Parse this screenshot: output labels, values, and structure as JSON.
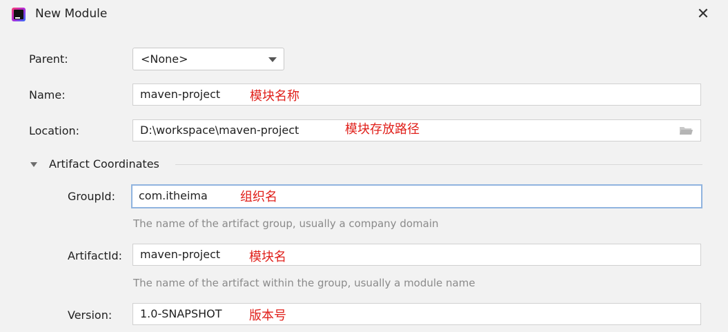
{
  "window": {
    "title": "New Module",
    "close_glyph": "✕"
  },
  "form": {
    "parent": {
      "label": "Parent:",
      "value": "<None>"
    },
    "name": {
      "label": "Name:",
      "value": "maven-project",
      "annotation": "模块名称"
    },
    "location": {
      "label": "Location:",
      "value": "D:\\workspace\\maven-project",
      "annotation": "模块存放路径"
    },
    "section": {
      "label": "Artifact Coordinates"
    },
    "group_id": {
      "label": "GroupId:",
      "value": "com.itheima",
      "annotation": "组织名",
      "hint": "The name of the artifact group, usually a company domain"
    },
    "artifact_id": {
      "label": "ArtifactId:",
      "value": "maven-project",
      "annotation": "模块名",
      "hint": "The name of the artifact within the group, usually a module name"
    },
    "version": {
      "label": "Version:",
      "value": "1.0-SNAPSHOT",
      "annotation": "版本号"
    }
  },
  "colors": {
    "annotation": "#e0201b",
    "focus_border": "#8fb3df",
    "hint": "#8a8a8a"
  }
}
